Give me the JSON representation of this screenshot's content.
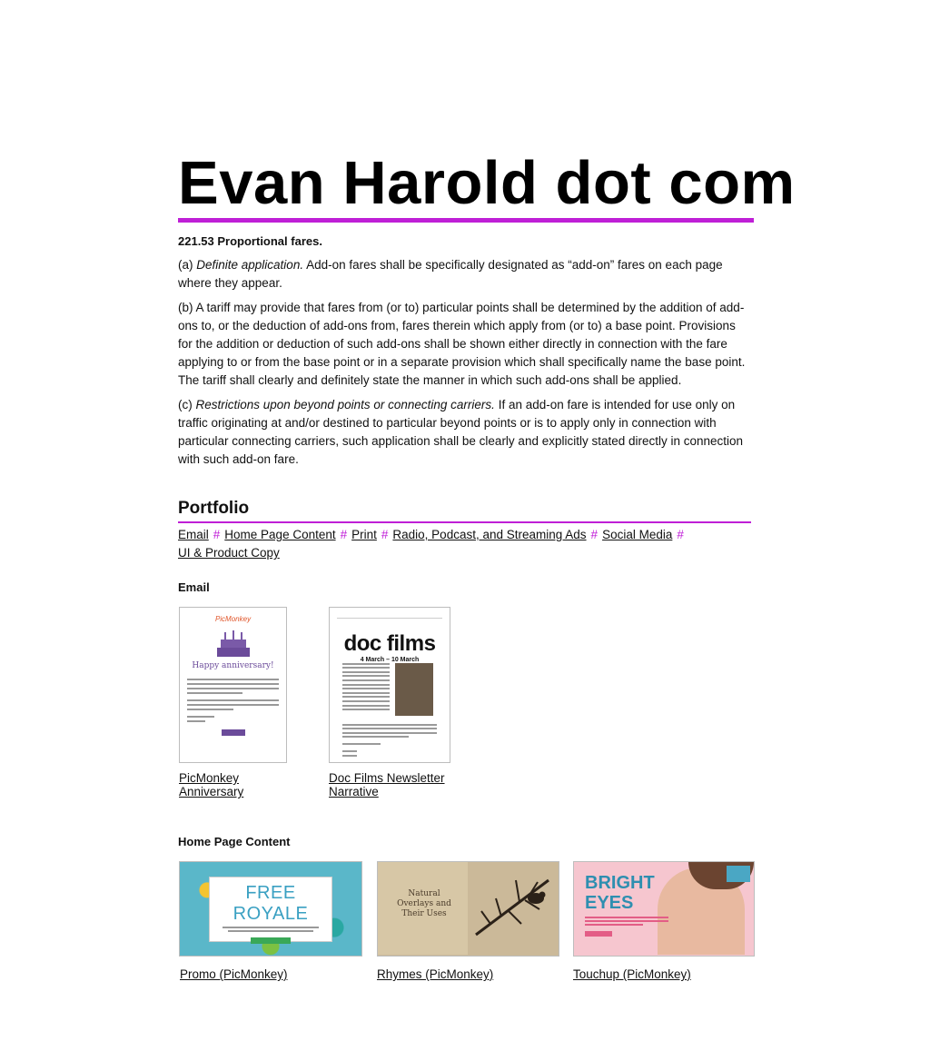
{
  "site": {
    "title": "Evan Harold dot com"
  },
  "regulation": {
    "heading": "221.53   Proportional fares.",
    "para_a_prefix": "(a) ",
    "para_a_italic": "Definite application.",
    "para_a_text": " Add-on fares shall be specifically designated as “add-on” fares on each page where they appear.",
    "para_b": "(b) A tariff may provide that fares from (or to) particular points shall be determined by the addition of add-ons to, or the deduction of add-ons from, fares therein which apply from (or to) a base point. Provisions for the addition or deduction of such add-ons shall be shown either directly in connection with the fare applying to or from the base point or in a separate provision which shall specifically name the base point. The tariff shall clearly and definitely state the manner in which such add-ons shall be applied.",
    "para_c_prefix": "(c) ",
    "para_c_italic": "Restrictions upon beyond points or connecting carriers.",
    "para_c_text": " If an add-on fare is intended for use only on traffic originating at and/or destined to particular beyond points or is to apply only in connection with particular connecting carriers, such application shall be clearly and explicitly stated directly in connection with such add-on fare."
  },
  "portfolio": {
    "heading": "Portfolio",
    "separator": "#",
    "categories": [
      "Email",
      "Home Page Content",
      "Print",
      "Radio, Podcast, and Streaming Ads",
      "Social Media",
      "UI & Product Copy"
    ],
    "email": {
      "heading": "Email",
      "items": [
        {
          "caption": "PicMonkey Anniversary",
          "thumb_logo": "PicMonkey",
          "thumb_text": "Happy anniversary!"
        },
        {
          "caption": "Doc Films Newsletter Narrative",
          "thumb_title": "doc films",
          "thumb_date": "4 March – 10 March"
        }
      ]
    },
    "home_page": {
      "heading": "Home Page Content",
      "items": [
        {
          "caption": "Promo (PicMonkey)",
          "thumb_title": "FREE ROYALE"
        },
        {
          "caption": "Rhymes (PicMonkey)",
          "thumb_title": "Natural Overlays and Their Uses"
        },
        {
          "caption": "Touchup (PicMonkey)",
          "thumb_title": "BRIGHT EYES"
        }
      ]
    }
  },
  "colors": {
    "accent": "#bf1fd6",
    "link": "#111111"
  }
}
